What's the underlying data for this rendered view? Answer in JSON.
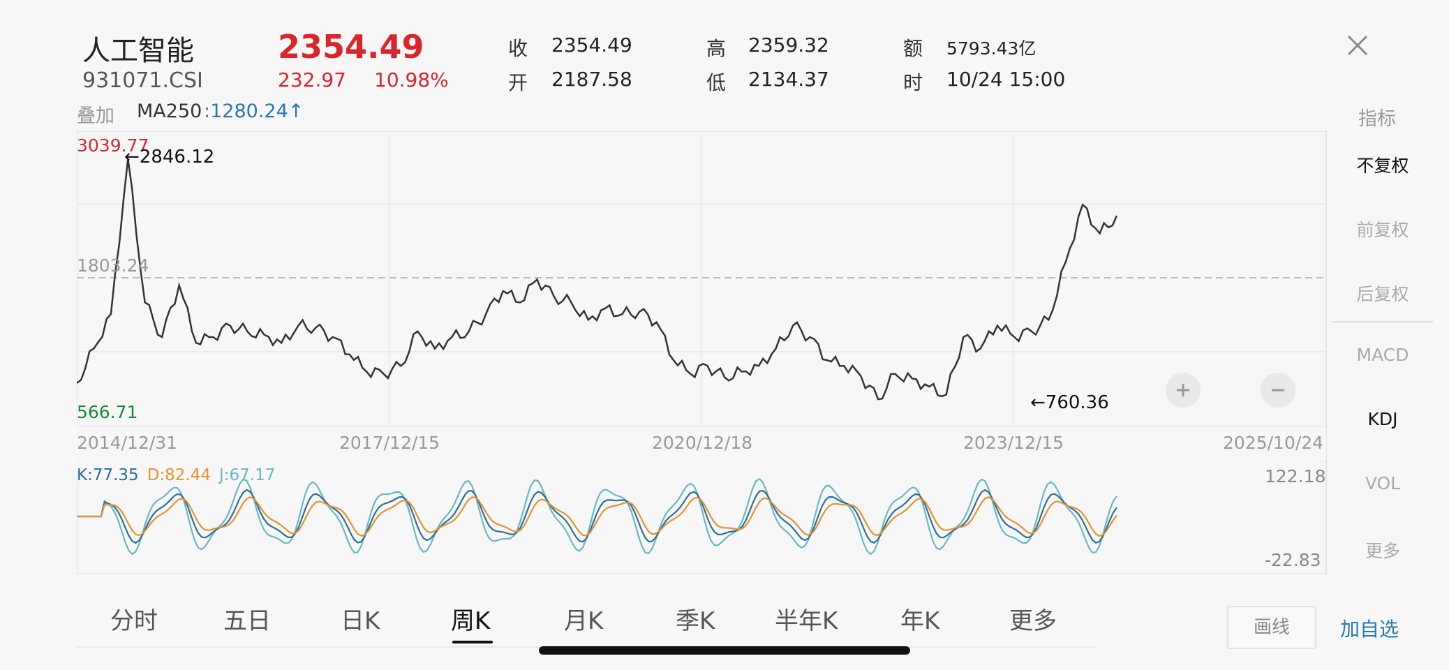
{
  "header": {
    "name": "人工智能",
    "code": "931071.CSI",
    "price": "2354.49",
    "change": "232.97",
    "change_pct": "10.98%",
    "stats": [
      {
        "label": "收",
        "value": "2354.49"
      },
      {
        "label": "开",
        "value": "2187.58"
      },
      {
        "label": "高",
        "value": "2359.32"
      },
      {
        "label": "低",
        "value": "2134.37"
      },
      {
        "label": "额",
        "value": "5793.43亿"
      },
      {
        "label": "时",
        "value": "10/24 15:00"
      }
    ]
  },
  "overlay_label": "叠加",
  "ma": {
    "label": "MA250",
    "value": ":1280.24↑"
  },
  "indicator_label": "指标",
  "main_chart": {
    "high_label": "3039.77",
    "low_label": "566.71",
    "mid_label": "1803.24",
    "peak_annotation": "←2846.12",
    "trough_annotation": "←760.36",
    "dates": [
      "2014/12/31",
      "2017/12/15",
      "2020/12/18",
      "2023/12/15",
      "2025/10/24"
    ]
  },
  "kdj": {
    "k": "K:77.35",
    "d": "D:82.44",
    "j": "J:67.17",
    "max": "122.18",
    "min": "-22.83"
  },
  "side_panel": {
    "items": [
      "不复权",
      "前复权",
      "后复权",
      "MACD",
      "KDJ",
      "VOL",
      "更多"
    ]
  },
  "tabs": [
    "分时",
    "五日",
    "日K",
    "周K",
    "月K",
    "季K",
    "半年K",
    "年K",
    "更多"
  ],
  "buttons": {
    "draw": "画线",
    "add_watch": "加自选"
  },
  "colors": {
    "up": "#d9262c",
    "down": "#1a8a3a",
    "k": "#2a6f9a",
    "d": "#e8912c",
    "j": "#6ab6c6",
    "accent": "#2a77b6"
  },
  "chart_data": {
    "type": "line",
    "x_range": [
      "2014/12/31",
      "2025/10/24"
    ],
    "ylim": [
      566.71,
      3039.77
    ],
    "series": [
      {
        "values": [
          900,
          1200,
          1500,
          2846.12,
          1600,
          1300,
          1750,
          1250,
          1300,
          1400,
          1350,
          1320,
          1250,
          1400,
          1380,
          1300,
          1150,
          1000,
          980,
          1050,
          1350,
          1200,
          1300,
          1350,
          1500,
          1700,
          1600,
          1800,
          1650,
          1600,
          1450,
          1550,
          1500,
          1520,
          1430,
          1100,
          980,
          1050,
          950,
          1000,
          1050,
          1200,
          1400,
          1300,
          1100,
          1050,
          960,
          760.36,
          980,
          940,
          870,
          800,
          1300,
          1200,
          1400,
          1300,
          1350,
          1450,
          1950,
          2450,
          2200,
          2354.49
        ]
      }
    ]
  }
}
